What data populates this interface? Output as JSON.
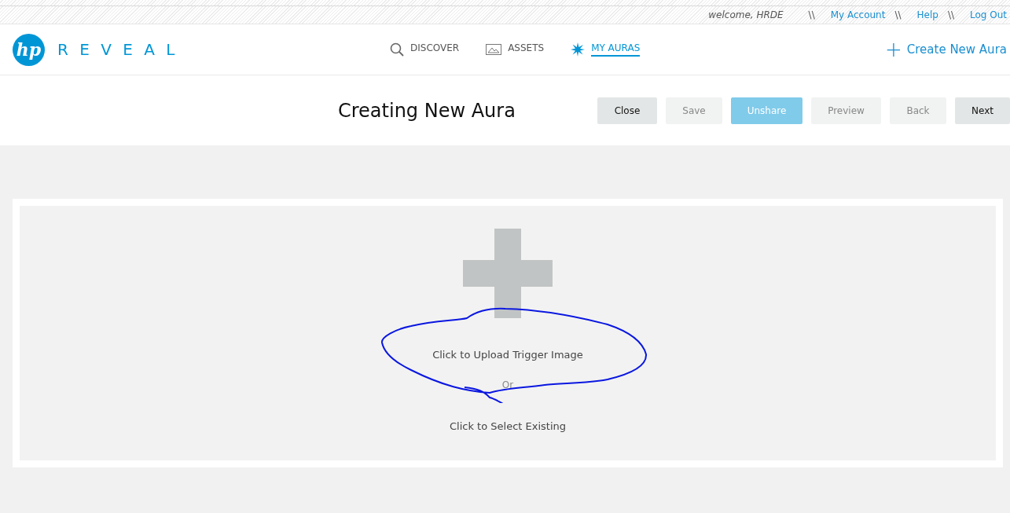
{
  "top_bar": {
    "welcome": "welcome, HRDE",
    "links": [
      {
        "separator": "\\\\",
        "label": "My Account"
      },
      {
        "separator": "\\\\",
        "label": "Help"
      },
      {
        "separator": "\\\\",
        "label": "Log Out"
      }
    ]
  },
  "logo": {
    "mark": "hp",
    "name": "R E V E A L"
  },
  "nav": [
    {
      "label": "DISCOVER",
      "kind": "search",
      "selected": false
    },
    {
      "label": "ASSETS",
      "kind": "image",
      "selected": false
    },
    {
      "label": "MY AURAS",
      "kind": "burst",
      "selected": true
    }
  ],
  "create_link": {
    "symbol": "+",
    "label": "Create New Aura"
  },
  "title": "Creating New Aura",
  "buttons": [
    {
      "label": "Close",
      "kind": "default",
      "disabled": false
    },
    {
      "label": "Save",
      "kind": "default",
      "disabled": true
    },
    {
      "label": "Unshare",
      "kind": "primary",
      "disabled": false
    },
    {
      "label": "Preview",
      "kind": "default",
      "disabled": true
    },
    {
      "label": "Back",
      "kind": "default",
      "disabled": true
    },
    {
      "label": "Next",
      "kind": "default",
      "disabled": false
    }
  ],
  "upload": {
    "primary": "Click to Upload Trigger Image",
    "separator": "Or",
    "secondary": "Click to Select Existing"
  }
}
